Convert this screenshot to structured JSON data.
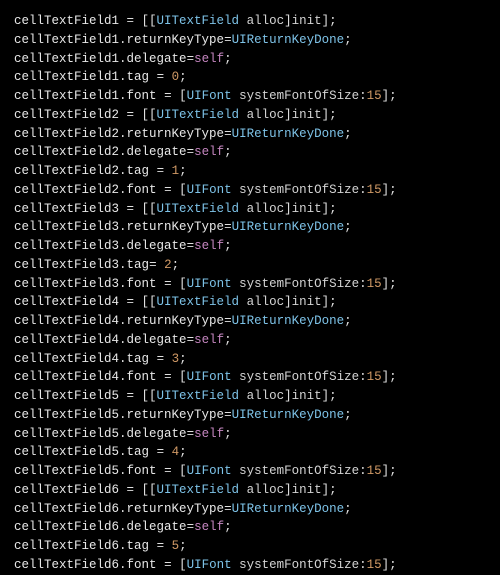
{
  "code": {
    "lines": [
      {
        "tokens": [
          {
            "t": "cellTextField1",
            "c": "ident"
          },
          {
            "t": " = [[",
            "c": "punct"
          },
          {
            "t": "UITextField",
            "c": "type"
          },
          {
            "t": " ",
            "c": "punct"
          },
          {
            "t": "alloc",
            "c": "method"
          },
          {
            "t": "]",
            "c": "punct"
          },
          {
            "t": "init",
            "c": "method"
          },
          {
            "t": "];",
            "c": "punct"
          }
        ]
      },
      {
        "tokens": [
          {
            "t": "cellTextField1",
            "c": "ident"
          },
          {
            "t": ".",
            "c": "punct"
          },
          {
            "t": "returnKeyType",
            "c": "prop"
          },
          {
            "t": "=",
            "c": "punct"
          },
          {
            "t": "UIReturnKeyDone",
            "c": "type"
          },
          {
            "t": ";",
            "c": "punct"
          }
        ]
      },
      {
        "tokens": [
          {
            "t": "cellTextField1",
            "c": "ident"
          },
          {
            "t": ".",
            "c": "punct"
          },
          {
            "t": "delegate",
            "c": "prop"
          },
          {
            "t": "=",
            "c": "punct"
          },
          {
            "t": "self",
            "c": "keyword"
          },
          {
            "t": ";",
            "c": "punct"
          }
        ]
      },
      {
        "tokens": [
          {
            "t": "cellTextField1",
            "c": "ident"
          },
          {
            "t": ".",
            "c": "punct"
          },
          {
            "t": "tag",
            "c": "prop"
          },
          {
            "t": " = ",
            "c": "punct"
          },
          {
            "t": "0",
            "c": "number"
          },
          {
            "t": ";",
            "c": "punct"
          }
        ]
      },
      {
        "tokens": [
          {
            "t": "cellTextField1",
            "c": "ident"
          },
          {
            "t": ".",
            "c": "punct"
          },
          {
            "t": "font",
            "c": "prop"
          },
          {
            "t": " = [",
            "c": "punct"
          },
          {
            "t": "UIFont",
            "c": "type"
          },
          {
            "t": " ",
            "c": "punct"
          },
          {
            "t": "systemFontOfSize",
            "c": "method"
          },
          {
            "t": ":",
            "c": "punct"
          },
          {
            "t": "15",
            "c": "number"
          },
          {
            "t": "];",
            "c": "punct"
          }
        ]
      },
      {
        "tokens": [
          {
            "t": "cellTextField2",
            "c": "ident"
          },
          {
            "t": " = [[",
            "c": "punct"
          },
          {
            "t": "UITextField",
            "c": "type"
          },
          {
            "t": " ",
            "c": "punct"
          },
          {
            "t": "alloc",
            "c": "method"
          },
          {
            "t": "]",
            "c": "punct"
          },
          {
            "t": "init",
            "c": "method"
          },
          {
            "t": "];",
            "c": "punct"
          }
        ]
      },
      {
        "tokens": [
          {
            "t": "cellTextField2",
            "c": "ident"
          },
          {
            "t": ".",
            "c": "punct"
          },
          {
            "t": "returnKeyType",
            "c": "prop"
          },
          {
            "t": "=",
            "c": "punct"
          },
          {
            "t": "UIReturnKeyDone",
            "c": "type"
          },
          {
            "t": ";",
            "c": "punct"
          }
        ]
      },
      {
        "tokens": [
          {
            "t": "cellTextField2",
            "c": "ident"
          },
          {
            "t": ".",
            "c": "punct"
          },
          {
            "t": "delegate",
            "c": "prop"
          },
          {
            "t": "=",
            "c": "punct"
          },
          {
            "t": "self",
            "c": "keyword"
          },
          {
            "t": ";",
            "c": "punct"
          }
        ]
      },
      {
        "tokens": [
          {
            "t": "cellTextField2",
            "c": "ident"
          },
          {
            "t": ".",
            "c": "punct"
          },
          {
            "t": "tag",
            "c": "prop"
          },
          {
            "t": " = ",
            "c": "punct"
          },
          {
            "t": "1",
            "c": "number"
          },
          {
            "t": ";",
            "c": "punct"
          }
        ]
      },
      {
        "tokens": [
          {
            "t": "cellTextField2",
            "c": "ident"
          },
          {
            "t": ".",
            "c": "punct"
          },
          {
            "t": "font",
            "c": "prop"
          },
          {
            "t": " = [",
            "c": "punct"
          },
          {
            "t": "UIFont",
            "c": "type"
          },
          {
            "t": " ",
            "c": "punct"
          },
          {
            "t": "systemFontOfSize",
            "c": "method"
          },
          {
            "t": ":",
            "c": "punct"
          },
          {
            "t": "15",
            "c": "number"
          },
          {
            "t": "];",
            "c": "punct"
          }
        ]
      },
      {
        "tokens": [
          {
            "t": "cellTextField3",
            "c": "ident"
          },
          {
            "t": " = [[",
            "c": "punct"
          },
          {
            "t": "UITextField",
            "c": "type"
          },
          {
            "t": " ",
            "c": "punct"
          },
          {
            "t": "alloc",
            "c": "method"
          },
          {
            "t": "]",
            "c": "punct"
          },
          {
            "t": "init",
            "c": "method"
          },
          {
            "t": "];",
            "c": "punct"
          }
        ]
      },
      {
        "tokens": [
          {
            "t": "cellTextField3",
            "c": "ident"
          },
          {
            "t": ".",
            "c": "punct"
          },
          {
            "t": "returnKeyType",
            "c": "prop"
          },
          {
            "t": "=",
            "c": "punct"
          },
          {
            "t": "UIReturnKeyDone",
            "c": "type"
          },
          {
            "t": ";",
            "c": "punct"
          }
        ]
      },
      {
        "tokens": [
          {
            "t": "cellTextField3",
            "c": "ident"
          },
          {
            "t": ".",
            "c": "punct"
          },
          {
            "t": "delegate",
            "c": "prop"
          },
          {
            "t": "=",
            "c": "punct"
          },
          {
            "t": "self",
            "c": "keyword"
          },
          {
            "t": ";",
            "c": "punct"
          }
        ]
      },
      {
        "tokens": [
          {
            "t": "cellTextField3",
            "c": "ident"
          },
          {
            "t": ".",
            "c": "punct"
          },
          {
            "t": "tag",
            "c": "prop"
          },
          {
            "t": "= ",
            "c": "punct"
          },
          {
            "t": "2",
            "c": "number"
          },
          {
            "t": ";",
            "c": "punct"
          }
        ]
      },
      {
        "tokens": [
          {
            "t": "cellTextField3",
            "c": "ident"
          },
          {
            "t": ".",
            "c": "punct"
          },
          {
            "t": "font",
            "c": "prop"
          },
          {
            "t": " = [",
            "c": "punct"
          },
          {
            "t": "UIFont",
            "c": "type"
          },
          {
            "t": " ",
            "c": "punct"
          },
          {
            "t": "systemFontOfSize",
            "c": "method"
          },
          {
            "t": ":",
            "c": "punct"
          },
          {
            "t": "15",
            "c": "number"
          },
          {
            "t": "];",
            "c": "punct"
          }
        ]
      },
      {
        "tokens": [
          {
            "t": "cellTextField4",
            "c": "ident"
          },
          {
            "t": " = [[",
            "c": "punct"
          },
          {
            "t": "UITextField",
            "c": "type"
          },
          {
            "t": " ",
            "c": "punct"
          },
          {
            "t": "alloc",
            "c": "method"
          },
          {
            "t": "]",
            "c": "punct"
          },
          {
            "t": "init",
            "c": "method"
          },
          {
            "t": "];",
            "c": "punct"
          }
        ]
      },
      {
        "tokens": [
          {
            "t": "cellTextField4",
            "c": "ident"
          },
          {
            "t": ".",
            "c": "punct"
          },
          {
            "t": "returnKeyType",
            "c": "prop"
          },
          {
            "t": "=",
            "c": "punct"
          },
          {
            "t": "UIReturnKeyDone",
            "c": "type"
          },
          {
            "t": ";",
            "c": "punct"
          }
        ]
      },
      {
        "tokens": [
          {
            "t": "cellTextField4",
            "c": "ident"
          },
          {
            "t": ".",
            "c": "punct"
          },
          {
            "t": "delegate",
            "c": "prop"
          },
          {
            "t": "=",
            "c": "punct"
          },
          {
            "t": "self",
            "c": "keyword"
          },
          {
            "t": ";",
            "c": "punct"
          }
        ]
      },
      {
        "tokens": [
          {
            "t": "cellTextField4",
            "c": "ident"
          },
          {
            "t": ".",
            "c": "punct"
          },
          {
            "t": "tag",
            "c": "prop"
          },
          {
            "t": " = ",
            "c": "punct"
          },
          {
            "t": "3",
            "c": "number"
          },
          {
            "t": ";",
            "c": "punct"
          }
        ]
      },
      {
        "tokens": [
          {
            "t": "cellTextField4",
            "c": "ident"
          },
          {
            "t": ".",
            "c": "punct"
          },
          {
            "t": "font",
            "c": "prop"
          },
          {
            "t": " = [",
            "c": "punct"
          },
          {
            "t": "UIFont",
            "c": "type"
          },
          {
            "t": " ",
            "c": "punct"
          },
          {
            "t": "systemFontOfSize",
            "c": "method"
          },
          {
            "t": ":",
            "c": "punct"
          },
          {
            "t": "15",
            "c": "number"
          },
          {
            "t": "];",
            "c": "punct"
          }
        ]
      },
      {
        "tokens": [
          {
            "t": "cellTextField5",
            "c": "ident"
          },
          {
            "t": " = [[",
            "c": "punct"
          },
          {
            "t": "UITextField",
            "c": "type"
          },
          {
            "t": " ",
            "c": "punct"
          },
          {
            "t": "alloc",
            "c": "method"
          },
          {
            "t": "]",
            "c": "punct"
          },
          {
            "t": "init",
            "c": "method"
          },
          {
            "t": "];",
            "c": "punct"
          }
        ]
      },
      {
        "tokens": [
          {
            "t": "cellTextField5",
            "c": "ident"
          },
          {
            "t": ".",
            "c": "punct"
          },
          {
            "t": "returnKeyType",
            "c": "prop"
          },
          {
            "t": "=",
            "c": "punct"
          },
          {
            "t": "UIReturnKeyDone",
            "c": "type"
          },
          {
            "t": ";",
            "c": "punct"
          }
        ]
      },
      {
        "tokens": [
          {
            "t": "cellTextField5",
            "c": "ident"
          },
          {
            "t": ".",
            "c": "punct"
          },
          {
            "t": "delegate",
            "c": "prop"
          },
          {
            "t": "=",
            "c": "punct"
          },
          {
            "t": "self",
            "c": "keyword"
          },
          {
            "t": ";",
            "c": "punct"
          }
        ]
      },
      {
        "tokens": [
          {
            "t": "cellTextField5",
            "c": "ident"
          },
          {
            "t": ".",
            "c": "punct"
          },
          {
            "t": "tag",
            "c": "prop"
          },
          {
            "t": " = ",
            "c": "punct"
          },
          {
            "t": "4",
            "c": "number"
          },
          {
            "t": ";",
            "c": "punct"
          }
        ]
      },
      {
        "tokens": [
          {
            "t": "cellTextField5",
            "c": "ident"
          },
          {
            "t": ".",
            "c": "punct"
          },
          {
            "t": "font",
            "c": "prop"
          },
          {
            "t": " = [",
            "c": "punct"
          },
          {
            "t": "UIFont",
            "c": "type"
          },
          {
            "t": " ",
            "c": "punct"
          },
          {
            "t": "systemFontOfSize",
            "c": "method"
          },
          {
            "t": ":",
            "c": "punct"
          },
          {
            "t": "15",
            "c": "number"
          },
          {
            "t": "];",
            "c": "punct"
          }
        ]
      },
      {
        "tokens": [
          {
            "t": "cellTextField6",
            "c": "ident"
          },
          {
            "t": " = [[",
            "c": "punct"
          },
          {
            "t": "UITextField",
            "c": "type"
          },
          {
            "t": " ",
            "c": "punct"
          },
          {
            "t": "alloc",
            "c": "method"
          },
          {
            "t": "]",
            "c": "punct"
          },
          {
            "t": "init",
            "c": "method"
          },
          {
            "t": "];",
            "c": "punct"
          }
        ]
      },
      {
        "tokens": [
          {
            "t": "cellTextField6",
            "c": "ident"
          },
          {
            "t": ".",
            "c": "punct"
          },
          {
            "t": "returnKeyType",
            "c": "prop"
          },
          {
            "t": "=",
            "c": "punct"
          },
          {
            "t": "UIReturnKeyDone",
            "c": "type"
          },
          {
            "t": ";",
            "c": "punct"
          }
        ]
      },
      {
        "tokens": [
          {
            "t": "cellTextField6",
            "c": "ident"
          },
          {
            "t": ".",
            "c": "punct"
          },
          {
            "t": "delegate",
            "c": "prop"
          },
          {
            "t": "=",
            "c": "punct"
          },
          {
            "t": "self",
            "c": "keyword"
          },
          {
            "t": ";",
            "c": "punct"
          }
        ]
      },
      {
        "tokens": [
          {
            "t": "cellTextField6",
            "c": "ident"
          },
          {
            "t": ".",
            "c": "punct"
          },
          {
            "t": "tag",
            "c": "prop"
          },
          {
            "t": " = ",
            "c": "punct"
          },
          {
            "t": "5",
            "c": "number"
          },
          {
            "t": ";",
            "c": "punct"
          }
        ]
      },
      {
        "tokens": [
          {
            "t": "cellTextField6",
            "c": "ident"
          },
          {
            "t": ".",
            "c": "punct"
          },
          {
            "t": "font",
            "c": "prop"
          },
          {
            "t": " = [",
            "c": "punct"
          },
          {
            "t": "UIFont",
            "c": "type"
          },
          {
            "t": " ",
            "c": "punct"
          },
          {
            "t": "systemFontOfSize",
            "c": "method"
          },
          {
            "t": ":",
            "c": "punct"
          },
          {
            "t": "15",
            "c": "number"
          },
          {
            "t": "];",
            "c": "punct"
          }
        ]
      }
    ]
  }
}
